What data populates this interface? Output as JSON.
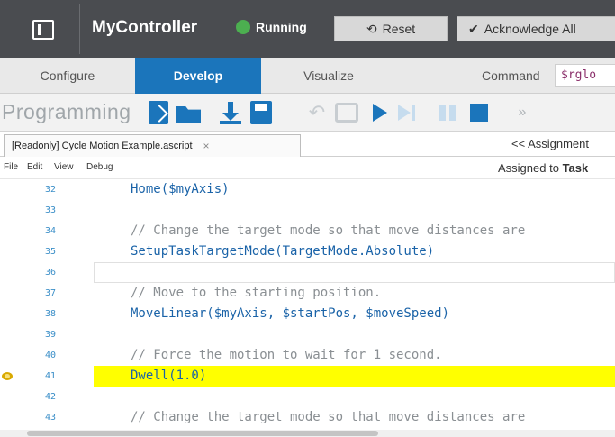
{
  "titlebar": {
    "app_title": "MyController",
    "status_label": "Running",
    "reset_label": "Reset",
    "acknowledge_label": "Acknowledge All",
    "colors": {
      "background": "#4a4c50",
      "status_ok": "#4caf50"
    }
  },
  "tabs": [
    {
      "label": "Configure",
      "active": false
    },
    {
      "label": "Develop",
      "active": true
    },
    {
      "label": "Visualize",
      "active": false
    }
  ],
  "command": {
    "label": "Command",
    "value": "$rglo"
  },
  "toolbar": {
    "section_title": "Programming",
    "icons": [
      "new-file-icon",
      "open-folder-icon",
      "download-icon",
      "save-icon",
      "undo-icon",
      "debug-icon",
      "play-icon",
      "step-icon",
      "pause-icon",
      "stop-icon",
      "more-icon"
    ],
    "accent": "#1b75bb"
  },
  "file_tab": {
    "label": "[Readonly] Cycle Motion Example.ascript",
    "close": "×"
  },
  "assignments_link": "<< Assignment",
  "menu": [
    "File",
    "Edit",
    "View",
    "Debug"
  ],
  "assigned_to": {
    "prefix": "Assigned to",
    "value": "Task"
  },
  "editor": {
    "current_line": "41",
    "lines": [
      {
        "num": "32",
        "code": "Home($myAxis)",
        "kind": "code"
      },
      {
        "num": "33",
        "code": "",
        "kind": "code"
      },
      {
        "num": "34",
        "code": "// Change the target mode so that move distances are",
        "kind": "comment"
      },
      {
        "num": "35",
        "code": "SetupTaskTargetMode(TargetMode.Absolute)",
        "kind": "code"
      },
      {
        "num": "36",
        "code": "",
        "kind": "code"
      },
      {
        "num": "37",
        "code": "// Move to the starting position.",
        "kind": "comment"
      },
      {
        "num": "38",
        "code": "MoveLinear($myAxis, $startPos, $moveSpeed)",
        "kind": "code"
      },
      {
        "num": "39",
        "code": "",
        "kind": "code"
      },
      {
        "num": "40",
        "code": "// Force the motion to wait for 1 second.",
        "kind": "comment"
      },
      {
        "num": "41",
        "code": "Dwell(1.0)",
        "kind": "code"
      },
      {
        "num": "42",
        "code": "",
        "kind": "code"
      },
      {
        "num": "43",
        "code": "// Change the target mode so that move distances are",
        "kind": "comment"
      }
    ],
    "highlight_color": "#ffff00"
  }
}
